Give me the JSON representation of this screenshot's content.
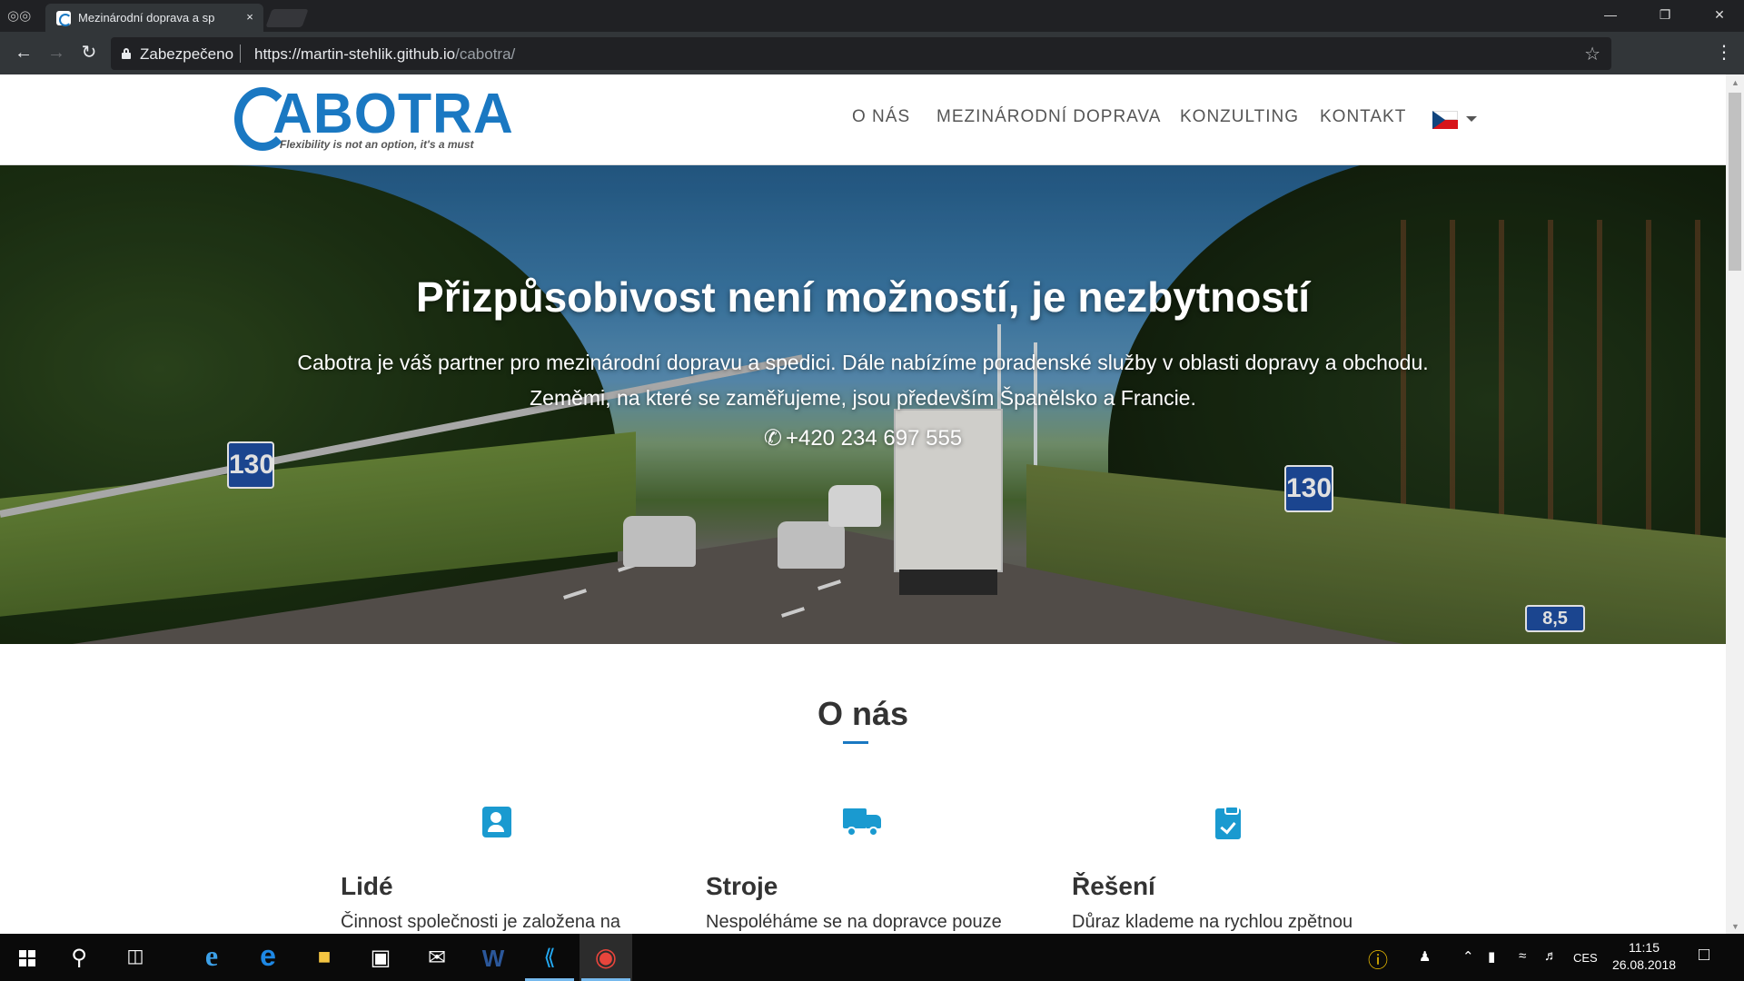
{
  "browser": {
    "tab_title": "Mezinárodní doprava a sp",
    "tab_close": "×",
    "security_label": "Zabezpečeno",
    "url_host": "https://martin-stehlik.github.io",
    "url_path": "/cabotra/"
  },
  "site": {
    "logo_word": "ABOTRA",
    "logo_tagline": "Flexibility is not an option, it's a must",
    "nav": [
      "O NÁS",
      "MEZINÁRODNÍ DOPRAVA",
      "KONZULTING",
      "KONTAKT"
    ],
    "language": "cs"
  },
  "hero": {
    "title": "Přizpůsobivost není možností, je nezbytností",
    "line1": "Cabotra je váš partner pro mezinárodní dopravu a spedici. Dále nabízíme poradenské služby v oblasti dopravy a obchodu.",
    "line2": "Zeměmi, na které se zaměřujeme, jsou především Španělsko a Francie.",
    "phone": "+420 234 697 555",
    "sign_left": "130",
    "sign_right": "130",
    "sign_km": "8,5"
  },
  "about": {
    "title": "O nás",
    "features": [
      {
        "icon": "contact-card-icon",
        "title": "Lidé",
        "text": "Činnost společnosti je založena na"
      },
      {
        "icon": "truck-icon",
        "title": "Stroje",
        "text": "Nespoléháme se na dopravce pouze"
      },
      {
        "icon": "clipboard-check-icon",
        "title": "Řešení",
        "text": "Důraz klademe na rychlou zpětnou"
      }
    ]
  },
  "taskbar": {
    "language": "CES",
    "time": "11:15",
    "date": "26.08.2018"
  },
  "colors": {
    "brand": "#1a78c2",
    "icon": "#1a9ad0"
  }
}
